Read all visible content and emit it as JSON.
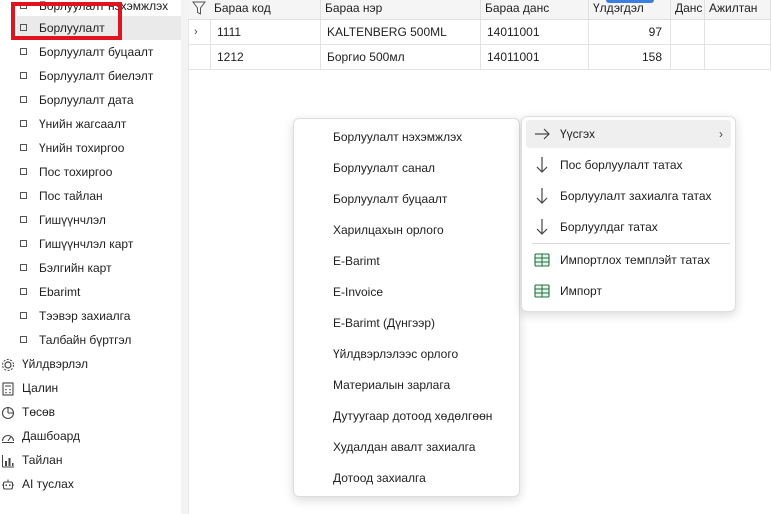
{
  "sidebar": {
    "sub_items": [
      {
        "label": "Борлуулалт нэхэмжлэх",
        "active": false
      },
      {
        "label": "Борлуулалт",
        "active": true
      },
      {
        "label": "Борлуулалт буцаалт",
        "active": false
      },
      {
        "label": "Борлуулалт биелэлт",
        "active": false
      },
      {
        "label": "Борлуулалт дата",
        "active": false
      },
      {
        "label": "Үнийн жагсаалт",
        "active": false
      },
      {
        "label": "Үнийн тохиргоо",
        "active": false
      },
      {
        "label": "Пос тохиргоо",
        "active": false
      },
      {
        "label": "Пос тайлан",
        "active": false
      },
      {
        "label": "Гишүүнчлэл",
        "active": false
      },
      {
        "label": "Гишүүнчлэл карт",
        "active": false
      },
      {
        "label": "Бэлгийн карт",
        "active": false
      },
      {
        "label": "Ebarimt",
        "active": false
      },
      {
        "label": "Тээвэр захиалга",
        "active": false
      },
      {
        "label": "Талбайн бүртгэл",
        "active": false
      }
    ],
    "main_items": [
      {
        "label": "Үйлдвэрлэл",
        "icon": "gear-icon"
      },
      {
        "label": "Цалин",
        "icon": "calculator-icon"
      },
      {
        "label": "Төсөв",
        "icon": "pie-chart-icon"
      },
      {
        "label": "Дашбоард",
        "icon": "dashboard-icon"
      },
      {
        "label": "Тайлан",
        "icon": "report-icon"
      },
      {
        "label": "AI туслах",
        "icon": "robot-icon"
      }
    ]
  },
  "grid": {
    "columns": [
      "Бараа код",
      "Бараа нэр",
      "Бараа данс",
      "Үлдэгдэл",
      "Данс",
      "Ажилтан"
    ],
    "rows": [
      {
        "code": "1111",
        "name": "KALTENBERG 500ML",
        "account": "14011001",
        "balance": "97"
      },
      {
        "code": "1212",
        "name": "Боргио 500мл",
        "account": "14011001",
        "balance": "158"
      }
    ]
  },
  "context_menu": {
    "items": [
      "Борлуулалт нэхэмжлэх",
      "Борлуулалт санал",
      "Борлуулалт буцаалт",
      "Харилцахын орлого",
      "E-Barimt",
      "E-Invoice",
      "E-Barimt (Дүнгээр)",
      "Үйлдвэрлэлээс орлого",
      "Материалын зарлага",
      "Дутуугаар дотоод хөдөлгөөн",
      "Худалдан авалт захиалга",
      "Дотоод захиалга"
    ]
  },
  "submenu": {
    "items": [
      {
        "label": "Үүсгэх",
        "icon": "arrow-right-icon",
        "has_submenu": true
      },
      {
        "label": "Пос борлуулалт татах",
        "icon": "arrow-down-icon"
      },
      {
        "label": "Борлуулалт захиалга татах",
        "icon": "arrow-down-icon"
      },
      {
        "label": "Борлуулдаг татах",
        "icon": "arrow-down-icon"
      },
      {
        "label": "Импортлох темплэйт татах",
        "icon": "excel-icon"
      },
      {
        "label": "Импорт",
        "icon": "excel-icon"
      }
    ]
  },
  "colors": {
    "highlight": "#e0141e",
    "accent": "#3b7de0",
    "excel_green": "#1e7145"
  }
}
